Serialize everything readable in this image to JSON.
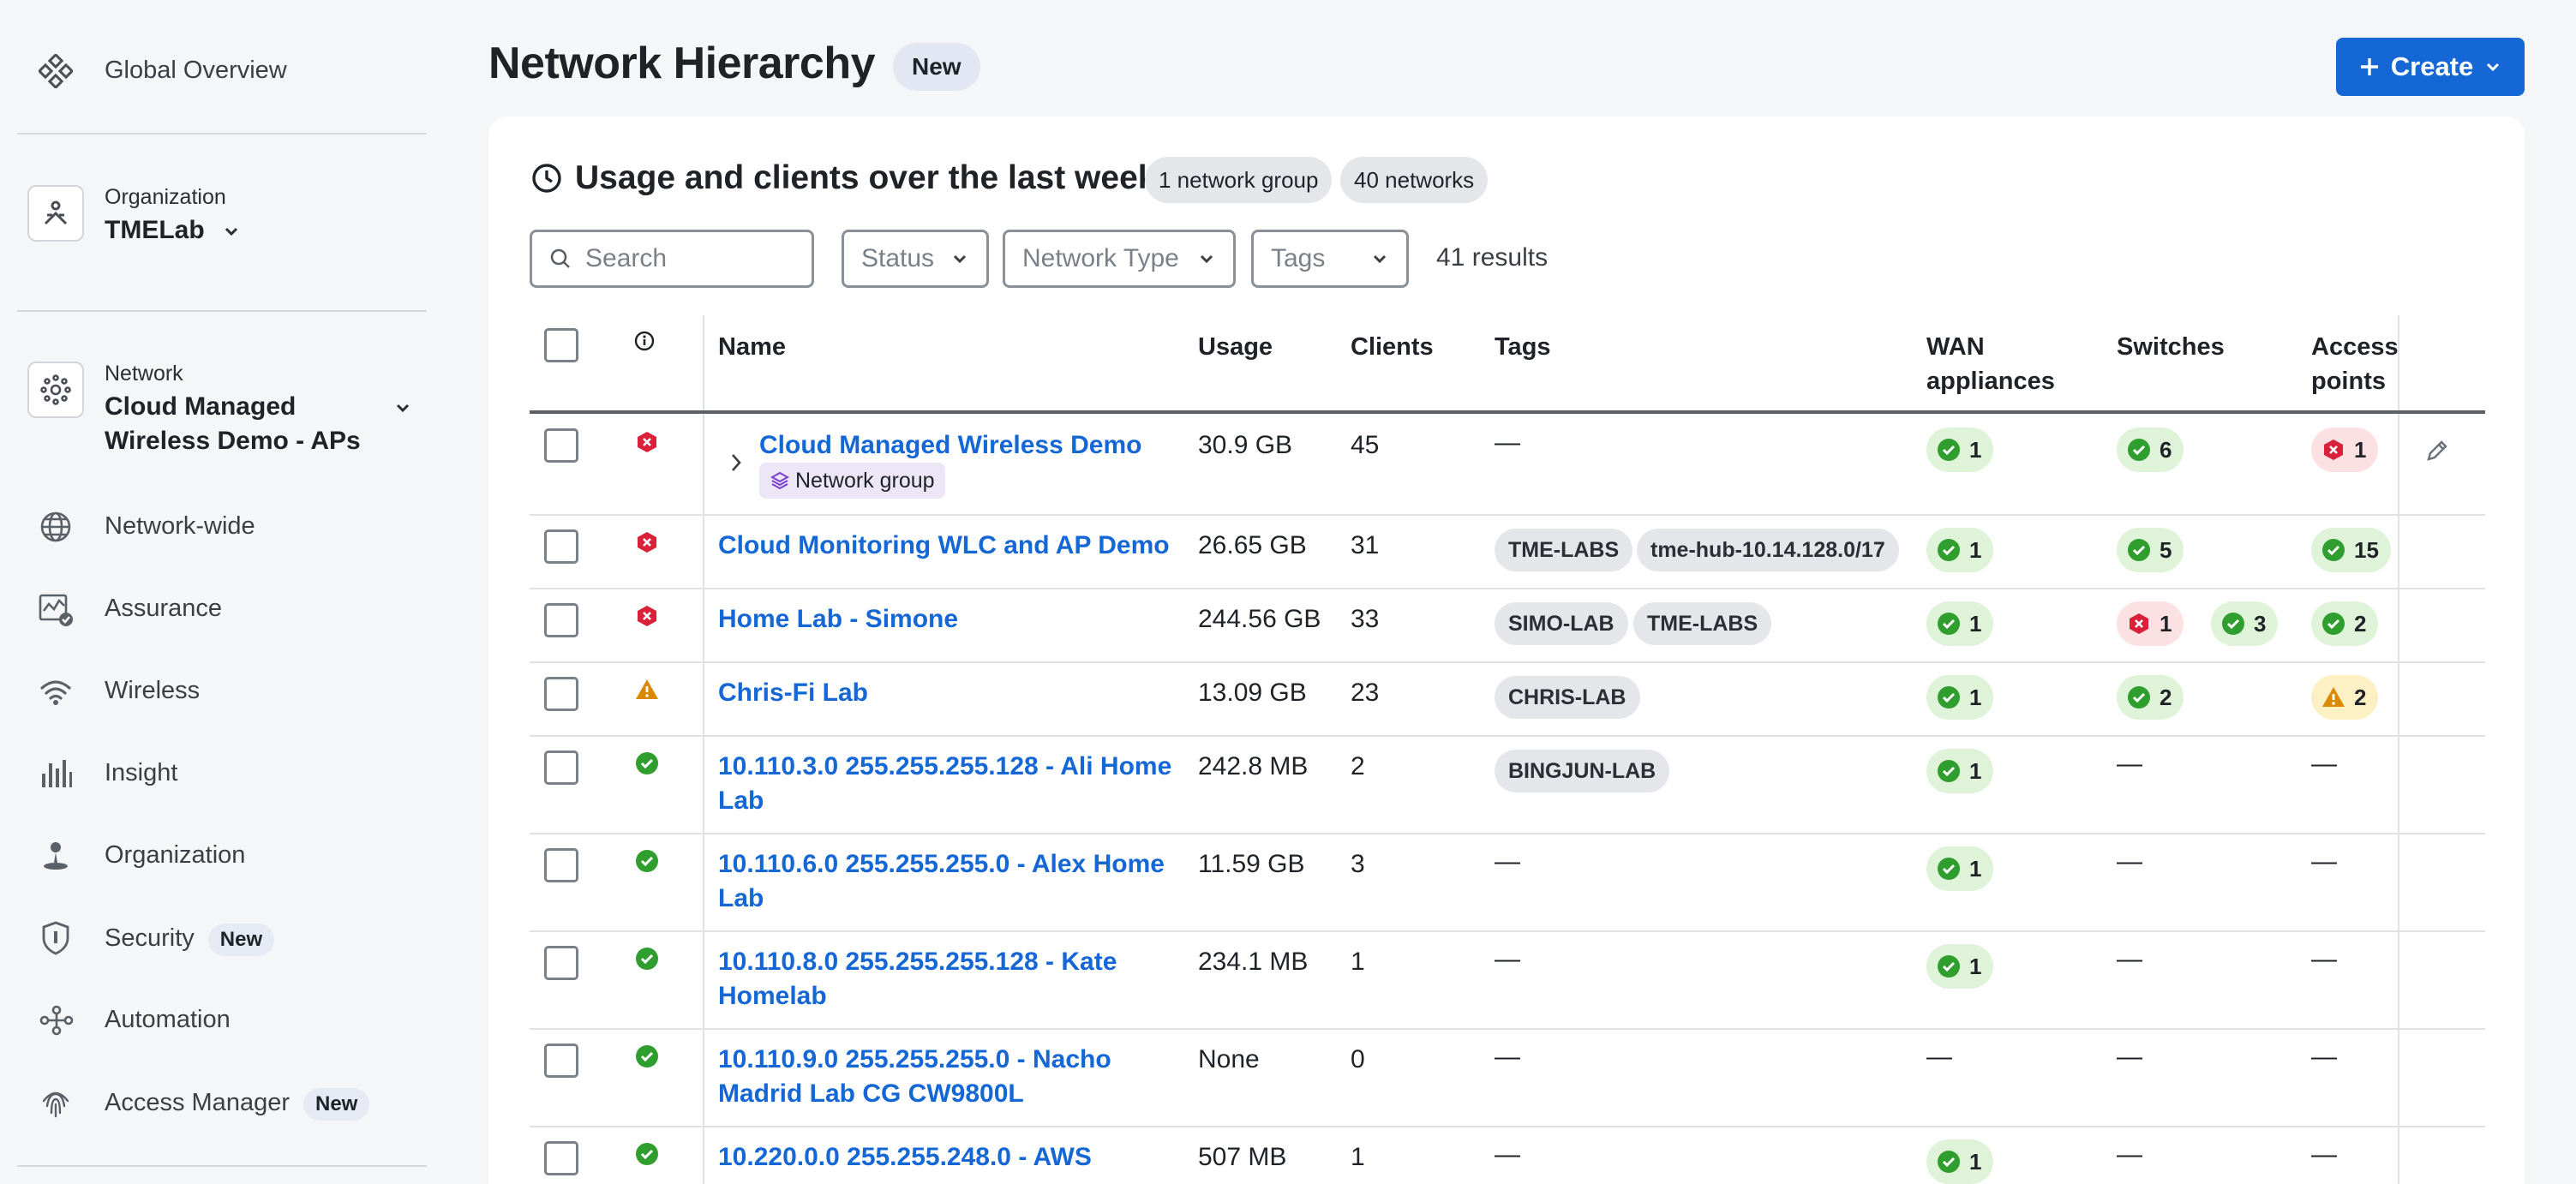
{
  "sidebar": {
    "global_overview": "Global Overview",
    "org_caption": "Organization",
    "org_value": "TMELab",
    "net_caption": "Network",
    "net_value_line1": "Cloud Managed",
    "net_value_line2": "Wireless Demo - APs",
    "nav": [
      {
        "label": "Network-wide",
        "icon": "globe-icon"
      },
      {
        "label": "Assurance",
        "icon": "assurance-icon"
      },
      {
        "label": "Wireless",
        "icon": "wifi-icon"
      },
      {
        "label": "Insight",
        "icon": "insight-icon"
      },
      {
        "label": "Organization",
        "icon": "organization-icon"
      },
      {
        "label": "Security",
        "icon": "shield-icon",
        "badge": "New"
      },
      {
        "label": "Automation",
        "icon": "automation-icon"
      },
      {
        "label": "Access Manager",
        "icon": "fingerprint-icon",
        "badge": "New"
      }
    ]
  },
  "header": {
    "title": "Network Hierarchy",
    "title_badge": "New",
    "create_label": "Create"
  },
  "card": {
    "title": "Usage and clients over the last week",
    "group_count": "1 network group",
    "network_count": "40 networks",
    "search_placeholder": "Search",
    "filter_status": "Status",
    "filter_type": "Network Type",
    "filter_tags": "Tags",
    "results": "41 results"
  },
  "table": {
    "headers": {
      "name": "Name",
      "usage": "Usage",
      "clients": "Clients",
      "tags": "Tags",
      "wan1": "WAN",
      "wan2": "appliances",
      "switches": "Switches",
      "ap1": "Access",
      "ap2": "points"
    },
    "group_label": "Network group",
    "dash": "—",
    "rows": [
      {
        "name": "Cloud Managed Wireless Demo",
        "usage": "30.9 GB",
        "clients": "45",
        "status": "error",
        "wan": "1",
        "sw_ok": "6",
        "ap_err": "1"
      },
      {
        "name": "Cloud Monitoring WLC and AP Demo",
        "usage": "26.65 GB",
        "clients": "31",
        "status": "error",
        "tags": [
          "TME-LABS",
          "tme-hub-10.14.128.0/17"
        ],
        "wan": "1",
        "sw_ok": "5",
        "ap_ok": "15"
      },
      {
        "name": "Home Lab - Simone",
        "usage": "244.56 GB",
        "clients": "33",
        "status": "error",
        "tags": [
          "SIMO-LAB",
          "TME-LABS"
        ],
        "wan": "1",
        "sw_err": "1",
        "sw_ok": "3",
        "ap_ok": "2"
      },
      {
        "name": "Chris-Fi Lab",
        "usage": "13.09 GB",
        "clients": "23",
        "status": "warning",
        "tags": [
          "CHRIS-LAB"
        ],
        "wan": "1",
        "sw_ok": "2",
        "ap_warn": "2"
      },
      {
        "name_line1": "10.110.3.0 255.255.255.128 - Ali Home",
        "name_line2": "Lab",
        "usage": "242.8 MB",
        "clients": "2",
        "status": "ok",
        "tags": [
          "BINGJUN-LAB"
        ],
        "wan": "1"
      },
      {
        "name_line1": "10.110.6.0 255.255.255.0 - Alex Home",
        "name_line2": "Lab",
        "usage": "11.59 GB",
        "clients": "3",
        "status": "ok",
        "wan": "1"
      },
      {
        "name_line1": "10.110.8.0 255.255.255.128 - Kate",
        "name_line2": "Homelab",
        "usage": "234.1 MB",
        "clients": "1",
        "status": "ok",
        "wan": "1"
      },
      {
        "name_line1": "10.110.9.0 255.255.255.0 - Nacho",
        "name_line2": "Madrid Lab CG CW9800L",
        "usage": "None",
        "clients": "0",
        "status": "ok"
      },
      {
        "name_line1": "10.220.0.0 255.255.248.0 - AWS",
        "usage": "507 MB",
        "clients": "1",
        "status": "ok",
        "wan": "1"
      }
    ]
  },
  "colors": {
    "link": "#1467d4",
    "ok": "#2f9e2f",
    "error": "#d9213a",
    "warning": "#d98a00",
    "primary_button": "#1467d4"
  }
}
